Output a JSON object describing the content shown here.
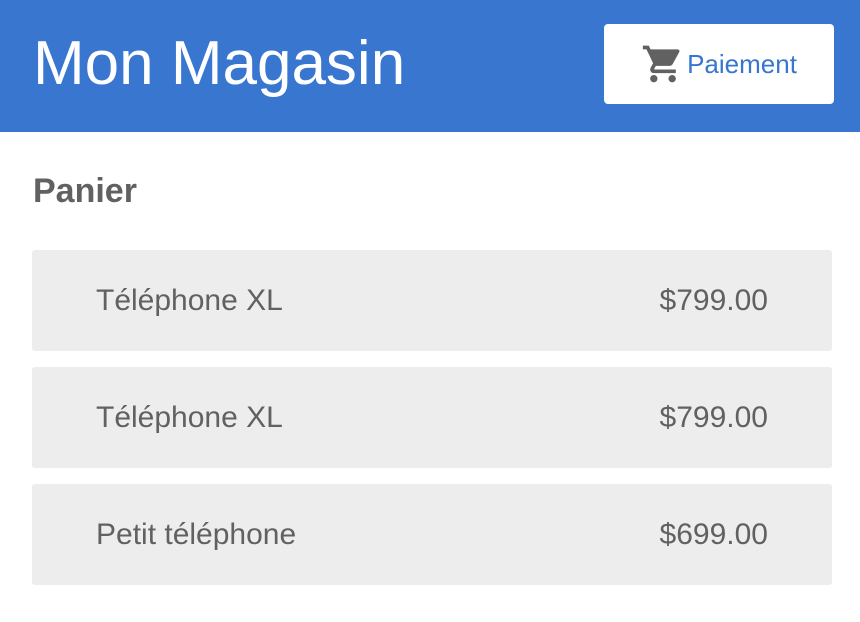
{
  "header": {
    "title": "Mon Magasin",
    "checkout_label": "Paiement",
    "checkout_icon": "shopping-cart-icon",
    "background_color": "#3876d0"
  },
  "cart": {
    "title": "Panier",
    "items": [
      {
        "name": "Téléphone XL",
        "price": "$799.00"
      },
      {
        "name": "Téléphone XL",
        "price": "$799.00"
      },
      {
        "name": "Petit téléphone",
        "price": "$699.00"
      }
    ]
  }
}
